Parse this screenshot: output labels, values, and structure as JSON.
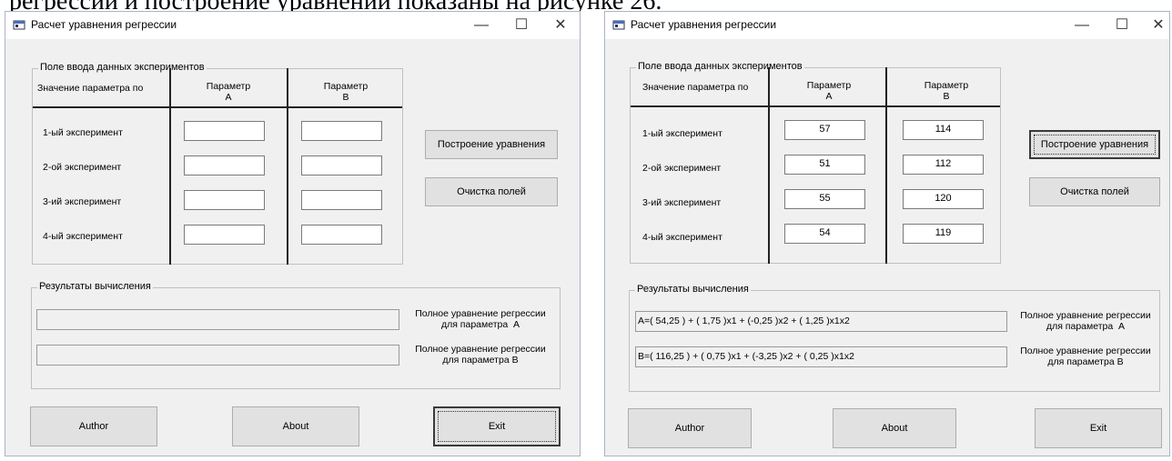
{
  "document_caption": "регрессии и построение уравнений показаны на рисунке 26.",
  "window_title": "Расчет уравнения регрессии",
  "window_controls": {
    "minimize": "—",
    "maximize": "☐",
    "close": "✕"
  },
  "input_group": {
    "label": "Поле ввода данных экспериментов",
    "row_header": "Значение параметра по",
    "param_a": "Параметр\nA",
    "param_b": "Параметр\nB",
    "rows": [
      "1-ый эксперимент",
      "2-ой эксперимент",
      "3-ий эксперимент",
      "4-ый эксперимент"
    ]
  },
  "buttons": {
    "build": "Построение уравнения",
    "clear": "Очистка полей",
    "author": "Author",
    "about": "About",
    "exit": "Exit"
  },
  "results_group": {
    "label": "Результаты вычисления",
    "label_a": "Полное уравнение регрессии\nдля параметра  A",
    "label_b": "Полное уравнение регрессии\nдля параметра B"
  },
  "window1": {
    "a_values": [
      "",
      "",
      "",
      ""
    ],
    "b_values": [
      "",
      "",
      "",
      ""
    ],
    "result_a": "",
    "result_b": ""
  },
  "window2": {
    "a_values": [
      "57",
      "51",
      "55",
      "54"
    ],
    "b_values": [
      "114",
      "112",
      "120",
      "119"
    ],
    "result_a": "A=( 54,25 ) + ( 1,75 )x1 + (-0,25 )x2 + ( 1,25 )x1x2",
    "result_b": "B=( 116,25 ) + ( 0,75 )x1 + (-3,25 )x2 + ( 0,25 )x1x2"
  }
}
